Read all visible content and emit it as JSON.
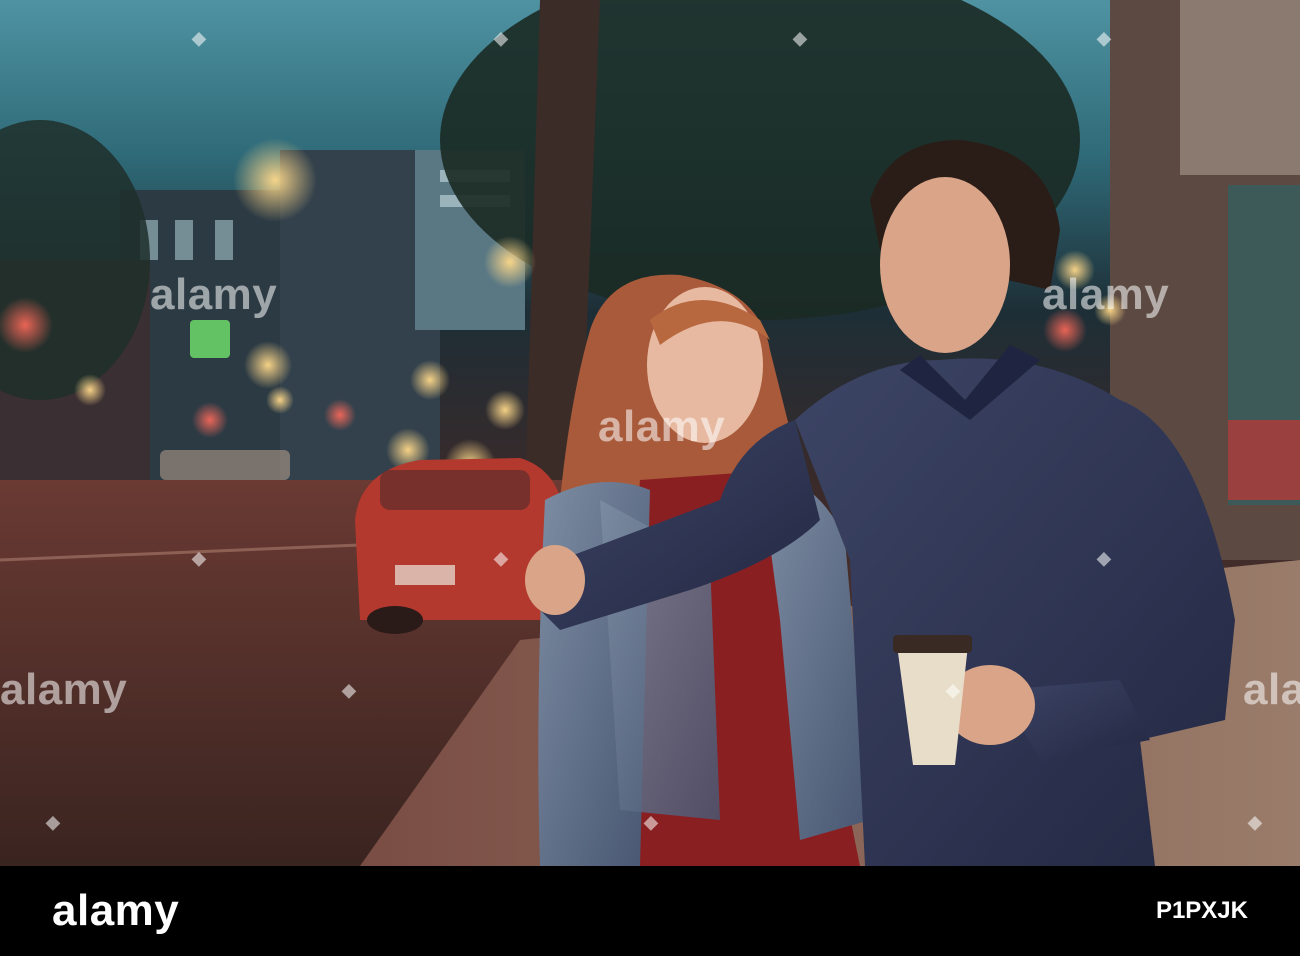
{
  "photo": {
    "subject": "couple-walking-city-street-night",
    "colors": {
      "sky": "#4f93a2",
      "street": "#4a2f2c",
      "car": "#b3392e",
      "jacket": "#5f6f86",
      "shirt": "#2f3552",
      "dress": "#8a1f22",
      "hair": "#a85a3a"
    }
  },
  "watermark": {
    "logo_text": "alamy",
    "mark_glyph": "◆"
  },
  "footer": {
    "logo_text": "alamy",
    "image_id": "P1PXJK",
    "background": "#000000"
  }
}
